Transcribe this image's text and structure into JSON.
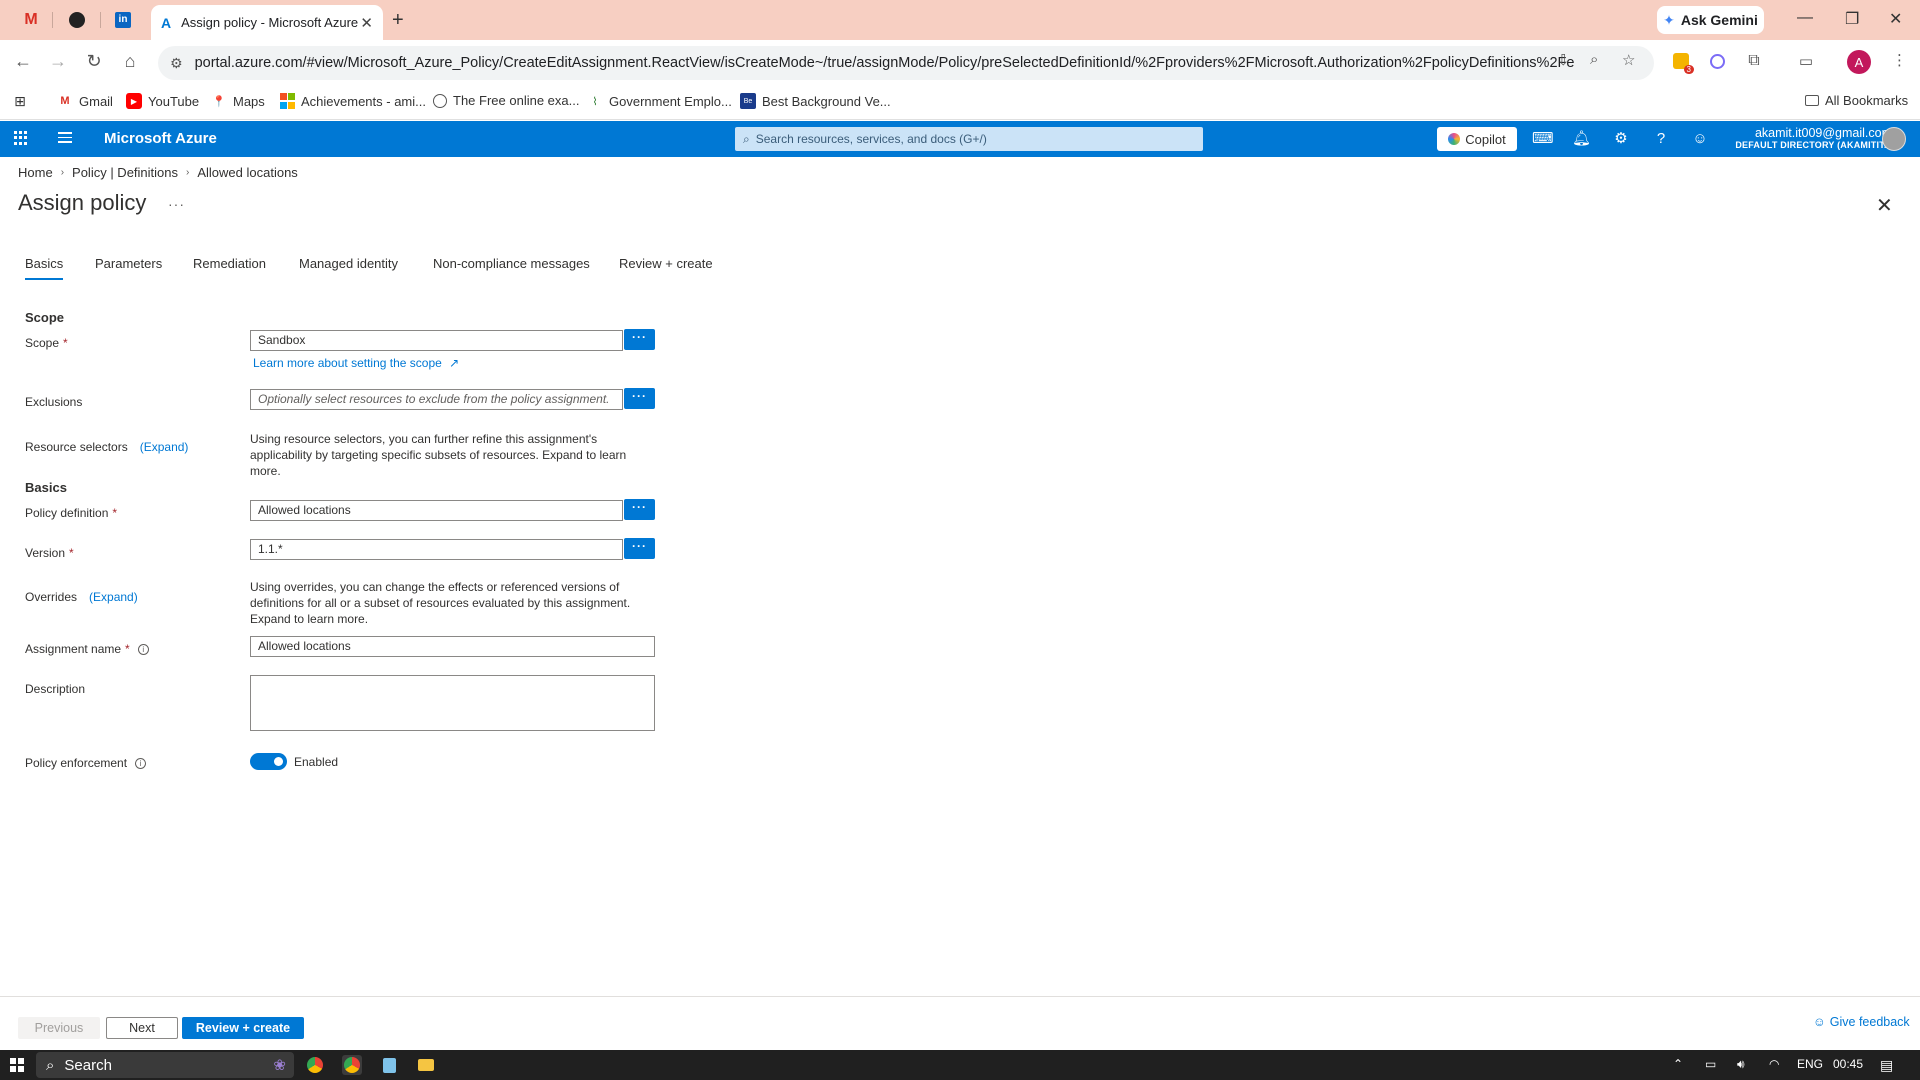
{
  "browser": {
    "active_tab_title": "Assign policy - Microsoft Azure",
    "ask_gemini": "Ask Gemini",
    "url": "portal.azure.com/#view/Microsoft_Azure_Policy/CreateEditAssignment.ReactView/isCreateMode~/true/assignMode/Policy/preSelectedDefinitionId/%2Fproviders%2FMicrosoft.Authorization%2FpolicyDefinitions%2Fe56...",
    "profile_initial": "A",
    "extension_badge": "3",
    "bookmarks": [
      "Gmail",
      "YouTube",
      "Maps",
      "Achievements - ami...",
      "The Free online exa...",
      "Government Emplo...",
      "Best Background Ve..."
    ],
    "all_bookmarks": "All Bookmarks"
  },
  "azure": {
    "brand": "Microsoft Azure",
    "search_placeholder": "Search resources, services, and docs (G+/)",
    "copilot": "Copilot",
    "account_email": "akamit.it009@gmail.com",
    "account_directory": "DEFAULT DIRECTORY (AKAMITIT..."
  },
  "breadcrumb": [
    "Home",
    "Policy | Definitions",
    "Allowed locations"
  ],
  "page": {
    "title": "Assign policy",
    "more": "···"
  },
  "tabs": [
    "Basics",
    "Parameters",
    "Remediation",
    "Managed identity",
    "Non-compliance messages",
    "Review + create"
  ],
  "form": {
    "scope_section": "Scope",
    "scope_label": "Scope",
    "scope_value": "Sandbox",
    "scope_link": "Learn more about setting the scope",
    "exclusions_label": "Exclusions",
    "exclusions_placeholder": "Optionally select resources to exclude from the policy assignment.",
    "resource_selectors_label": "Resource selectors",
    "expand": "(Expand)",
    "resource_selectors_help": "Using resource selectors, you can further refine this assignment's applicability by targeting specific subsets of resources. Expand to learn more.",
    "basics_section": "Basics",
    "policy_definition_label": "Policy definition",
    "policy_definition_value": "Allowed locations",
    "version_label": "Version",
    "version_value": "1.1.*",
    "overrides_label": "Overrides",
    "overrides_help": "Using overrides, you can change the effects or referenced versions of definitions for all or a subset of resources evaluated by this assignment. Expand to learn more.",
    "assignment_name_label": "Assignment name",
    "assignment_name_value": "Allowed locations",
    "description_label": "Description",
    "policy_enforcement_label": "Policy enforcement",
    "policy_enforcement_value": "Enabled",
    "required_mark": "*",
    "dots": "···"
  },
  "footer": {
    "previous": "Previous",
    "next": "Next",
    "review_create": "Review + create",
    "feedback": "Give feedback"
  },
  "taskbar": {
    "search": "Search",
    "lang": "ENG",
    "time": "00:45"
  },
  "colors": {
    "azure_blue": "#0078d4",
    "tab_strip": "#f7cfc2",
    "required": "#a4262c"
  }
}
